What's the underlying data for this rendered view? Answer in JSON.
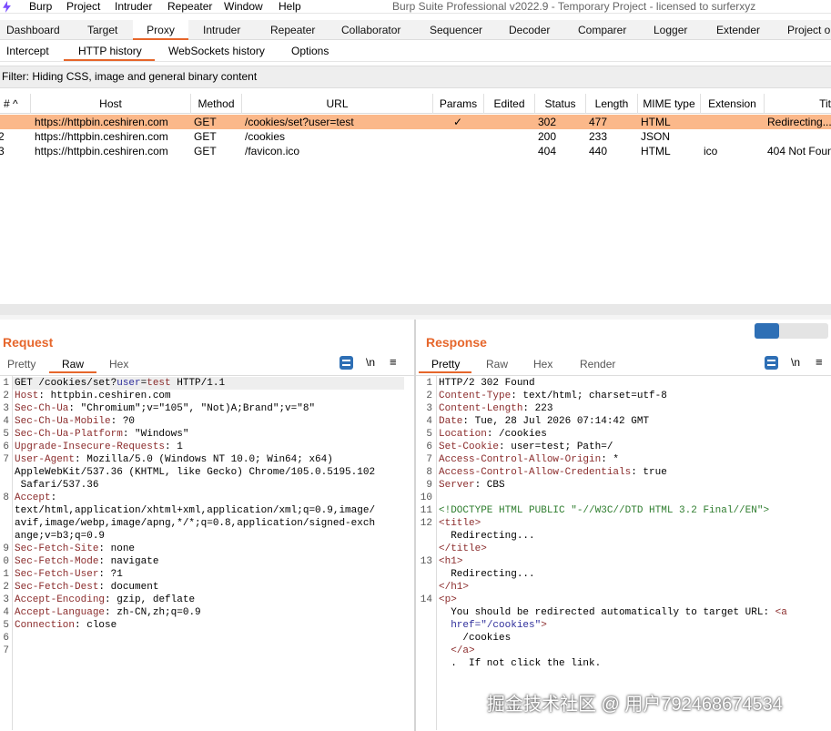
{
  "menubar": {
    "items": [
      "Burp",
      "Project",
      "Intruder",
      "Repeater",
      "Window",
      "Help"
    ],
    "title": "Burp Suite Professional v2022.9 - Temporary Project - licensed to surferxyz"
  },
  "tabs": [
    "Dashboard",
    "Target",
    "Proxy",
    "Intruder",
    "Repeater",
    "Collaborator",
    "Sequencer",
    "Decoder",
    "Comparer",
    "Logger",
    "Extender",
    "Project o"
  ],
  "subtabs": [
    "Intercept",
    "HTTP history",
    "WebSockets history",
    "Options"
  ],
  "filter": "Filter: Hiding CSS, image and general binary content",
  "table": {
    "columns": [
      "# ^",
      "Host",
      "Method",
      "URL",
      "Params",
      "Edited",
      "Status",
      "Length",
      "MIME type",
      "Extension",
      "Tit"
    ],
    "rows": [
      {
        "num": "",
        "host": "https://httpbin.ceshiren.com",
        "method": "GET",
        "url": "/cookies/set?user=test",
        "params": "✓",
        "edited": "",
        "status": "302",
        "length": "477",
        "mime": "HTML",
        "ext": "",
        "title": "Redirecting..."
      },
      {
        "num": "2",
        "host": "https://httpbin.ceshiren.com",
        "method": "GET",
        "url": "/cookies",
        "params": "",
        "edited": "",
        "status": "200",
        "length": "233",
        "mime": "JSON",
        "ext": "",
        "title": ""
      },
      {
        "num": "3",
        "host": "https://httpbin.ceshiren.com",
        "method": "GET",
        "url": "/favicon.ico",
        "params": "",
        "edited": "",
        "status": "404",
        "length": "440",
        "mime": "HTML",
        "ext": "ico",
        "title": "404 Not Foun"
      }
    ]
  },
  "request": {
    "title": "Request",
    "tabs": [
      "Pretty",
      "Raw",
      "Hex"
    ],
    "newline": "\\n",
    "menu": "≡",
    "lines": [
      {
        "n": "1",
        "k": "",
        "v": "GET /cookies/set?user=test HTTP/1.1"
      },
      {
        "n": "2",
        "k": "Host",
        "v": ": httpbin.ceshiren.com"
      },
      {
        "n": "3",
        "k": "Sec-Ch-Ua",
        "v": ": \"Chromium\";v=\"105\", \"Not)A;Brand\";v=\"8\""
      },
      {
        "n": "4",
        "k": "Sec-Ch-Ua-Mobile",
        "v": ": ?0"
      },
      {
        "n": "5",
        "k": "Sec-Ch-Ua-Platform",
        "v": ": \"Windows\""
      },
      {
        "n": "6",
        "k": "Upgrade-Insecure-Requests",
        "v": ": 1"
      },
      {
        "n": "7",
        "k": "User-Agent",
        "v": ": Mozilla/5.0 (Windows NT 10.0; Win64; x64)"
      },
      {
        "n": "",
        "k": "",
        "v": "AppleWebKit/537.36 (KHTML, like Gecko) Chrome/105.0.5195.102"
      },
      {
        "n": "",
        "k": "",
        "v": " Safari/537.36"
      },
      {
        "n": "8",
        "k": "Accept",
        "v": ":"
      },
      {
        "n": "",
        "k": "",
        "v": "text/html,application/xhtml+xml,application/xml;q=0.9,image/"
      },
      {
        "n": "",
        "k": "",
        "v": "avif,image/webp,image/apng,*/*;q=0.8,application/signed-exch"
      },
      {
        "n": "",
        "k": "",
        "v": "ange;v=b3;q=0.9"
      },
      {
        "n": "9",
        "k": "Sec-Fetch-Site",
        "v": ": none"
      },
      {
        "n": "0",
        "k": "Sec-Fetch-Mode",
        "v": ": navigate"
      },
      {
        "n": "1",
        "k": "Sec-Fetch-User",
        "v": ": ?1"
      },
      {
        "n": "2",
        "k": "Sec-Fetch-Dest",
        "v": ": document"
      },
      {
        "n": "3",
        "k": "Accept-Encoding",
        "v": ": gzip, deflate"
      },
      {
        "n": "4",
        "k": "Accept-Language",
        "v": ": zh-CN,zh;q=0.9"
      },
      {
        "n": "5",
        "k": "Connection",
        "v": ": close"
      },
      {
        "n": "6",
        "k": "",
        "v": ""
      },
      {
        "n": "7",
        "k": "",
        "v": ""
      }
    ]
  },
  "response": {
    "title": "Response",
    "tabs": [
      "Pretty",
      "Raw",
      "Hex",
      "Render"
    ],
    "newline": "\\n",
    "menu": "≡",
    "lines": [
      {
        "n": "1",
        "k": "",
        "v": "HTTP/2 302 Found"
      },
      {
        "n": "2",
        "k": "Content-Type",
        "v": ": text/html; charset=utf-8"
      },
      {
        "n": "3",
        "k": "Content-Length",
        "v": ": 223"
      },
      {
        "n": "4",
        "k": "Date",
        "v": ": Tue, 28 Jul 2026 07:14:42 GMT"
      },
      {
        "n": "5",
        "k": "Location",
        "v": ": /cookies"
      },
      {
        "n": "6",
        "k": "Set-Cookie",
        "v": ": user=test; Path=/"
      },
      {
        "n": "7",
        "k": "Access-Control-Allow-Origin",
        "v": ": *"
      },
      {
        "n": "8",
        "k": "Access-Control-Allow-Credentials",
        "v": ": true"
      },
      {
        "n": "9",
        "k": "Server",
        "v": ": CBS"
      },
      {
        "n": "10",
        "k": "",
        "v": ""
      },
      {
        "n": "11",
        "k": "",
        "v": "<!DOCTYPE HTML PUBLIC \"-//W3C//DTD HTML 3.2 Final//EN\">"
      },
      {
        "n": "12",
        "k": "",
        "v": "<title>"
      },
      {
        "n": "",
        "k": "",
        "v": "  Redirecting..."
      },
      {
        "n": "",
        "k": "",
        "v": "</title>"
      },
      {
        "n": "13",
        "k": "",
        "v": "<h1>"
      },
      {
        "n": "",
        "k": "",
        "v": "  Redirecting..."
      },
      {
        "n": "",
        "k": "",
        "v": "</h1>"
      },
      {
        "n": "14",
        "k": "",
        "v": "<p>"
      },
      {
        "n": "",
        "k": "",
        "v": "  You should be redirected automatically to target URL: <a"
      },
      {
        "n": "",
        "k": "",
        "v": "  href=\"/cookies\">"
      },
      {
        "n": "",
        "k": "",
        "v": "    /cookies"
      },
      {
        "n": "",
        "k": "",
        "v": "  </a>"
      },
      {
        "n": "",
        "k": "",
        "v": "  .  If not click the link."
      }
    ]
  },
  "watermark": "掘金技术社区 @ 用户792468674534"
}
